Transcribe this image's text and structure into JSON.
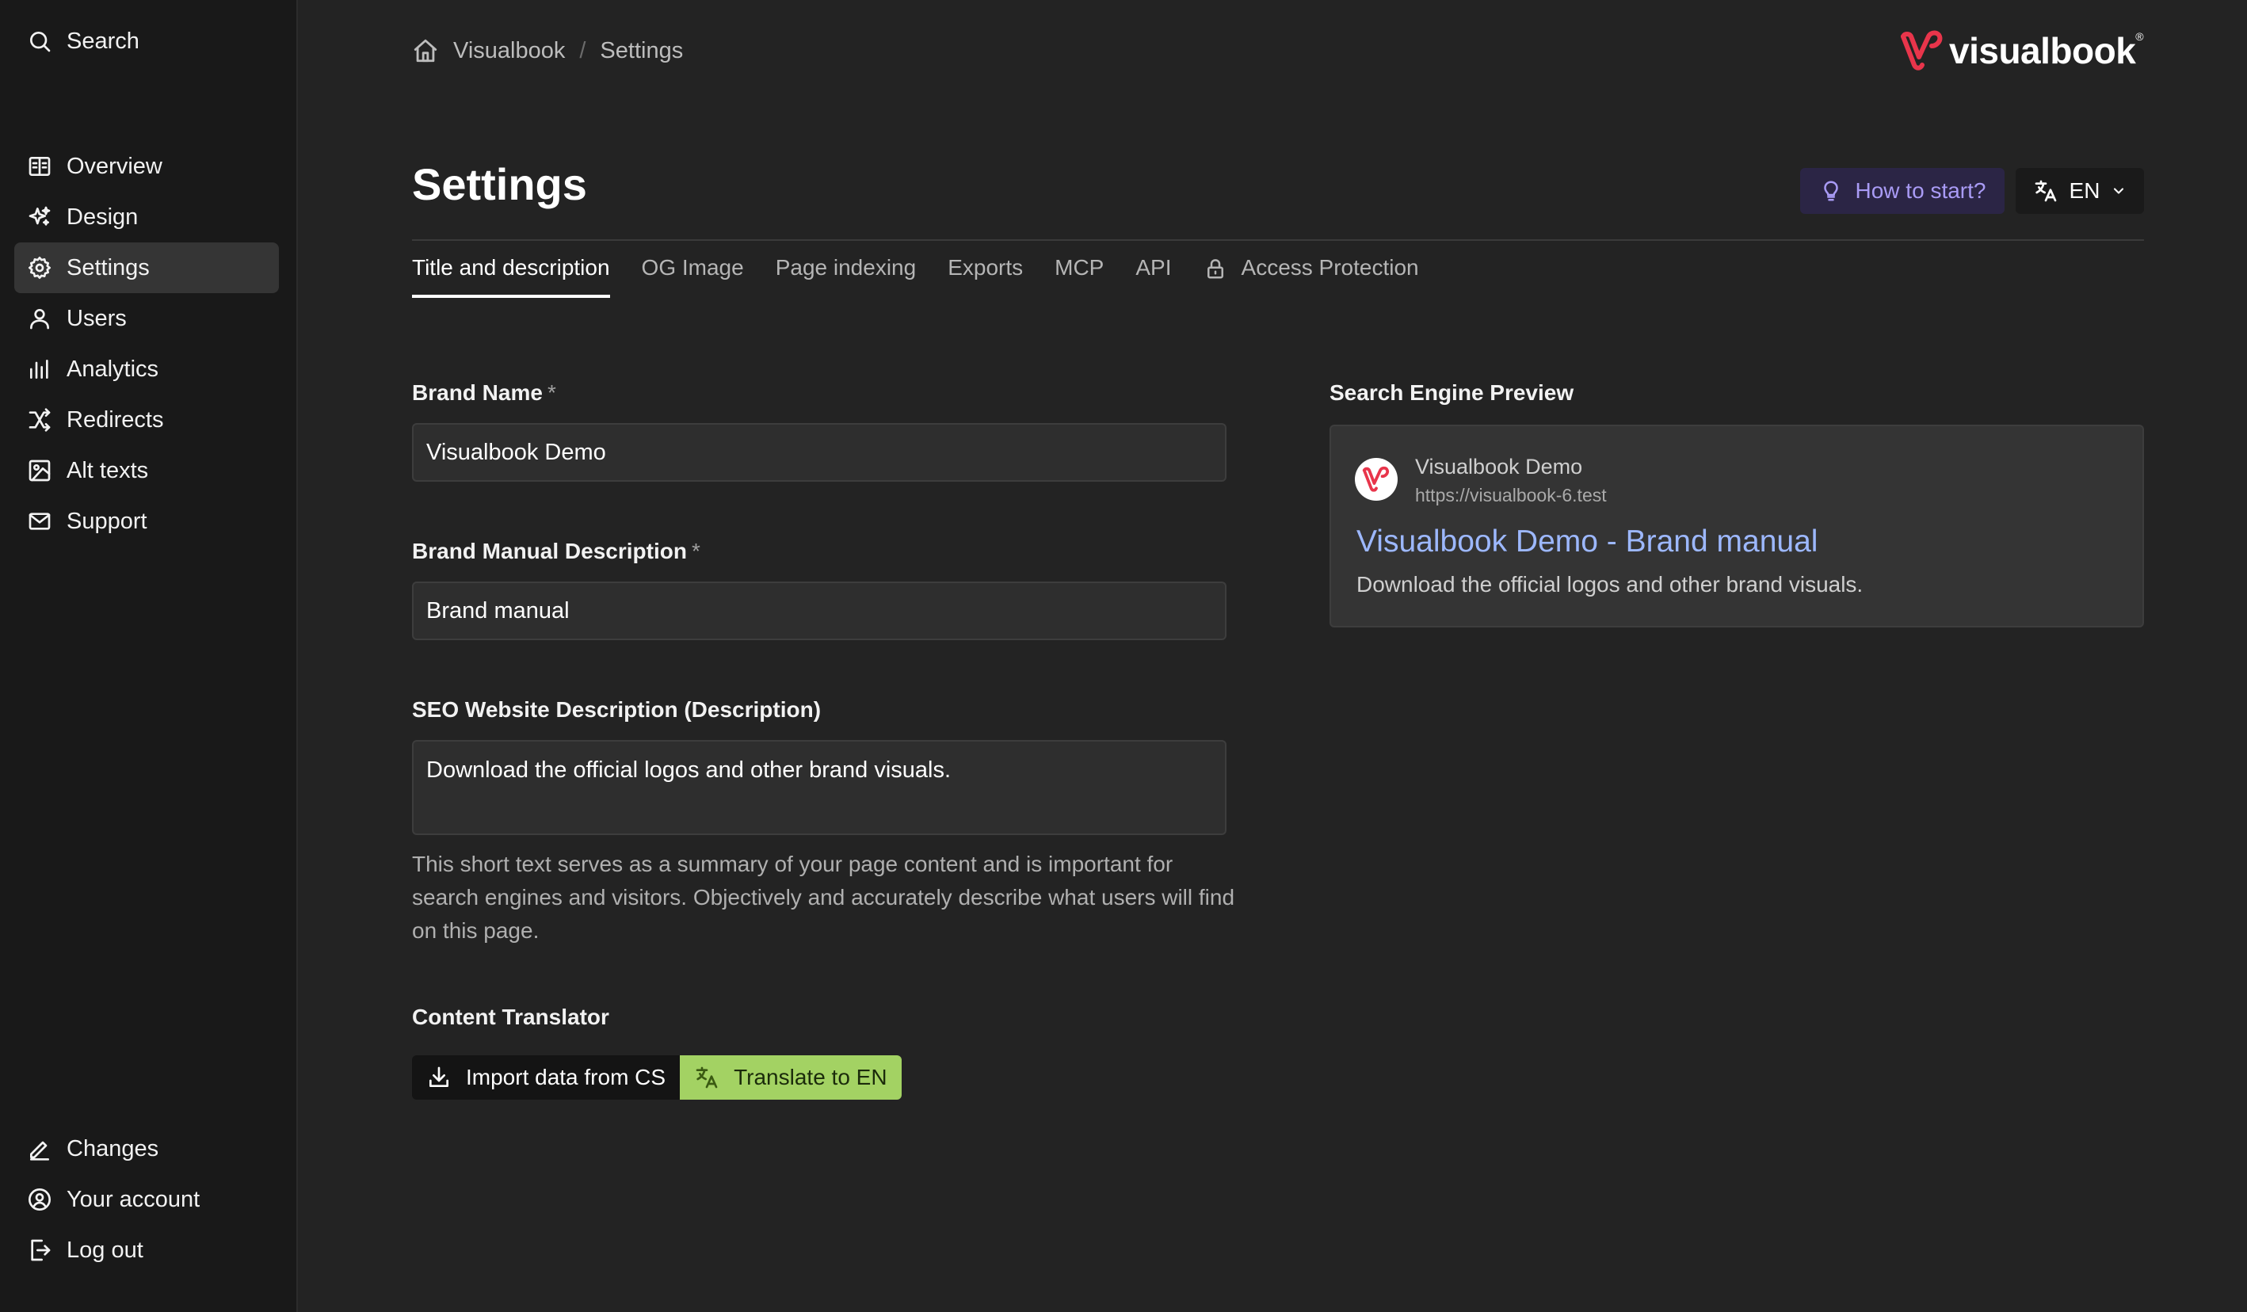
{
  "sidebar": {
    "search": "Search",
    "items": [
      {
        "label": "Overview",
        "icon": "book-open-icon"
      },
      {
        "label": "Design",
        "icon": "sparkles-icon"
      },
      {
        "label": "Settings",
        "icon": "gear-icon",
        "active": true
      },
      {
        "label": "Users",
        "icon": "user-icon"
      },
      {
        "label": "Analytics",
        "icon": "bar-chart-icon"
      },
      {
        "label": "Redirects",
        "icon": "shuffle-icon"
      },
      {
        "label": "Alt texts",
        "icon": "image-icon"
      },
      {
        "label": "Support",
        "icon": "mail-icon"
      }
    ],
    "bottom": [
      {
        "label": "Changes",
        "icon": "pencil-icon"
      },
      {
        "label": "Your account",
        "icon": "user-circle-icon"
      },
      {
        "label": "Log out",
        "icon": "logout-icon"
      }
    ]
  },
  "breadcrumb": [
    "Visualbook",
    "Settings"
  ],
  "brand": {
    "logo_text": "visualbook",
    "reg": "®",
    "accent": "#e8354b"
  },
  "page": {
    "title": "Settings"
  },
  "actions": {
    "how_to_start": "How to start?",
    "language": "EN"
  },
  "tabs": [
    {
      "label": "Title and description",
      "active": true
    },
    {
      "label": "OG Image"
    },
    {
      "label": "Page indexing"
    },
    {
      "label": "Exports"
    },
    {
      "label": "MCP"
    },
    {
      "label": "API"
    },
    {
      "label": "Access Protection",
      "icon": "lock-icon"
    }
  ],
  "form": {
    "brand_name": {
      "label": "Brand Name",
      "required": "*",
      "value": "Visualbook Demo"
    },
    "manual_desc": {
      "label": "Brand Manual Description",
      "required": "*",
      "value": "Brand manual"
    },
    "seo_desc": {
      "label": "SEO Website Description (Description)",
      "value": "Download the official logos and other brand visuals.",
      "help": "This short text serves as a summary of your page content and is important for search engines and visitors. Objectively and accurately describe what users will find on this page."
    },
    "translator": {
      "label": "Content Translator",
      "import_label": "Import data from CS",
      "translate_label": "Translate to EN"
    }
  },
  "preview": {
    "label": "Search Engine Preview",
    "site_name": "Visualbook Demo",
    "url": "https://visualbook-6.test",
    "title": "Visualbook Demo - Brand manual",
    "description": "Download the official logos and other brand visuals."
  },
  "colors": {
    "bg": "#232323",
    "sidebar": "#191919",
    "link": "#9db8ff",
    "translate": "#a3d263",
    "how": "#a99bf5"
  }
}
